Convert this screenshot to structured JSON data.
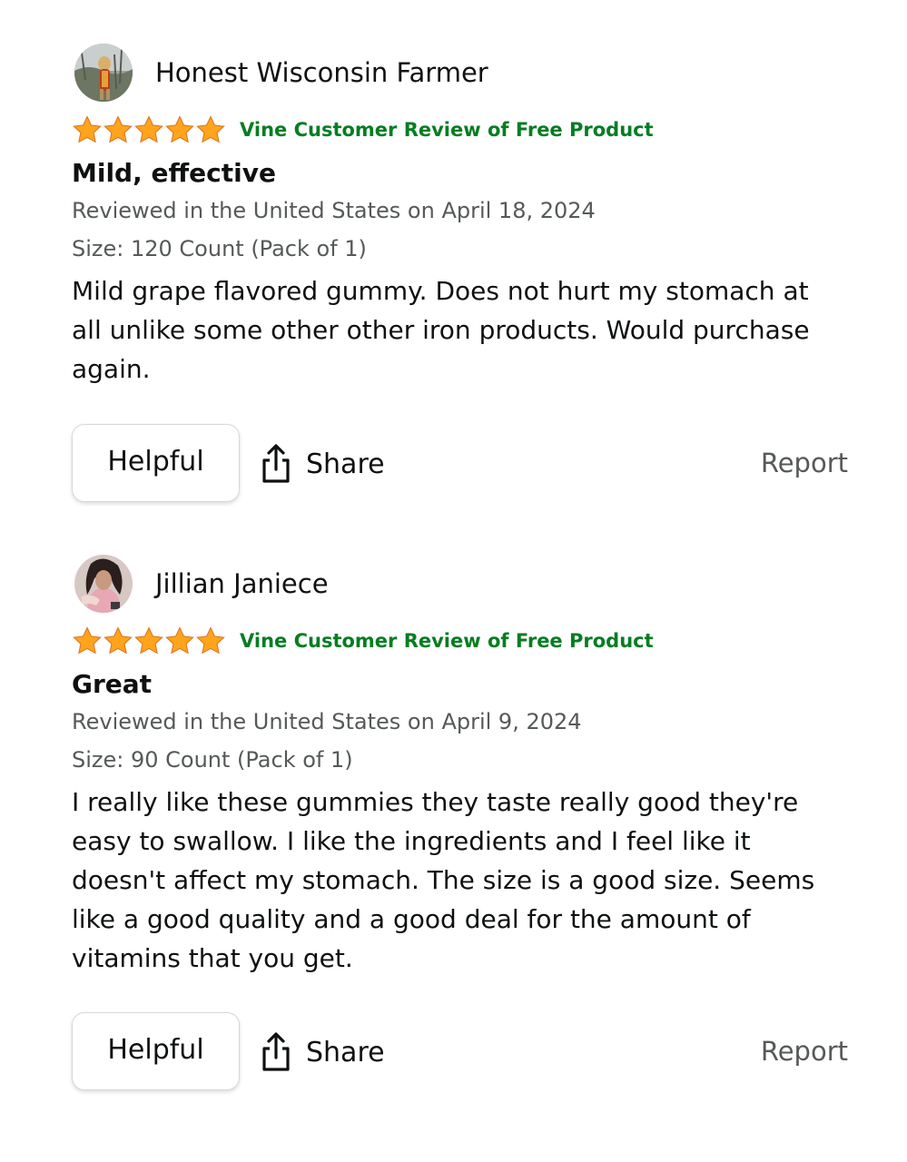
{
  "star_color": "#ffa41c",
  "vine_color": "#067d22",
  "reviews": [
    {
      "reviewer_name": "Honest Wisconsin Farmer",
      "avatar_icon": "reviewer-photo-dog",
      "rating": 5,
      "rating_max": 5,
      "vine_badge": "Vine Customer Review of Free Product",
      "title": "Mild, effective",
      "reviewed_line": "Reviewed in the United States on April 18, 2024",
      "size_line": "Size: 120 Count (Pack of 1)",
      "body": "Mild grape flavored gummy. Does not hurt my stomach at all unlike some other other iron products. Would purchase again.",
      "helpful_label": "Helpful",
      "share_label": "Share",
      "share_icon": "share-icon",
      "report_label": "Report"
    },
    {
      "reviewer_name": "Jillian Janiece",
      "avatar_icon": "reviewer-photo-woman",
      "rating": 5,
      "rating_max": 5,
      "vine_badge": "Vine Customer Review of Free Product",
      "title": "Great",
      "reviewed_line": "Reviewed in the United States on April 9, 2024",
      "size_line": "Size: 90 Count (Pack of 1)",
      "body": "I really like these gummies they taste really good they're easy to swallow. I like the ingredients and I feel like it doesn't affect my stomach. The size is a good size. Seems like a good quality and a good deal for the amount of vitamins that you get.",
      "helpful_label": "Helpful",
      "share_label": "Share",
      "share_icon": "share-icon",
      "report_label": "Report"
    }
  ]
}
